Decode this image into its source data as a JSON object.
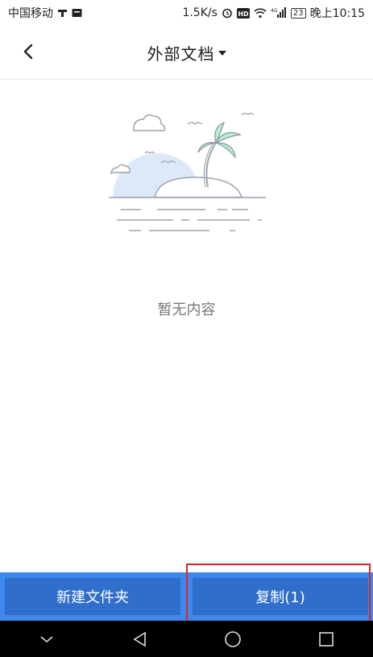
{
  "status_bar": {
    "carrier": "中国移动",
    "network_speed": "1.5K/s",
    "network_type": "4G",
    "battery": "23",
    "time": "晚上10:15",
    "icons": [
      "taobao-icon",
      "message-icon",
      "alarm-icon",
      "hd-icon",
      "wifi-icon",
      "signal-icon",
      "battery-icon"
    ]
  },
  "header": {
    "back_icon": "chevron-left-icon",
    "title": "外部文档",
    "title_dropdown_icon": "caret-down-icon"
  },
  "empty_state": {
    "illustration": "island-palm-illustration",
    "message": "暂无内容"
  },
  "bottom_bar": {
    "new_folder_label": "新建文件夹",
    "copy_label": "复制(1)"
  },
  "nav_bar": {
    "icons": [
      "chevron-down-icon",
      "back-triangle-icon",
      "home-circle-icon",
      "recents-square-icon"
    ]
  },
  "colors": {
    "bottom_bar_bg": "#3d88ea",
    "button_bg": "#2f6fcb",
    "highlight": "#e02424"
  }
}
